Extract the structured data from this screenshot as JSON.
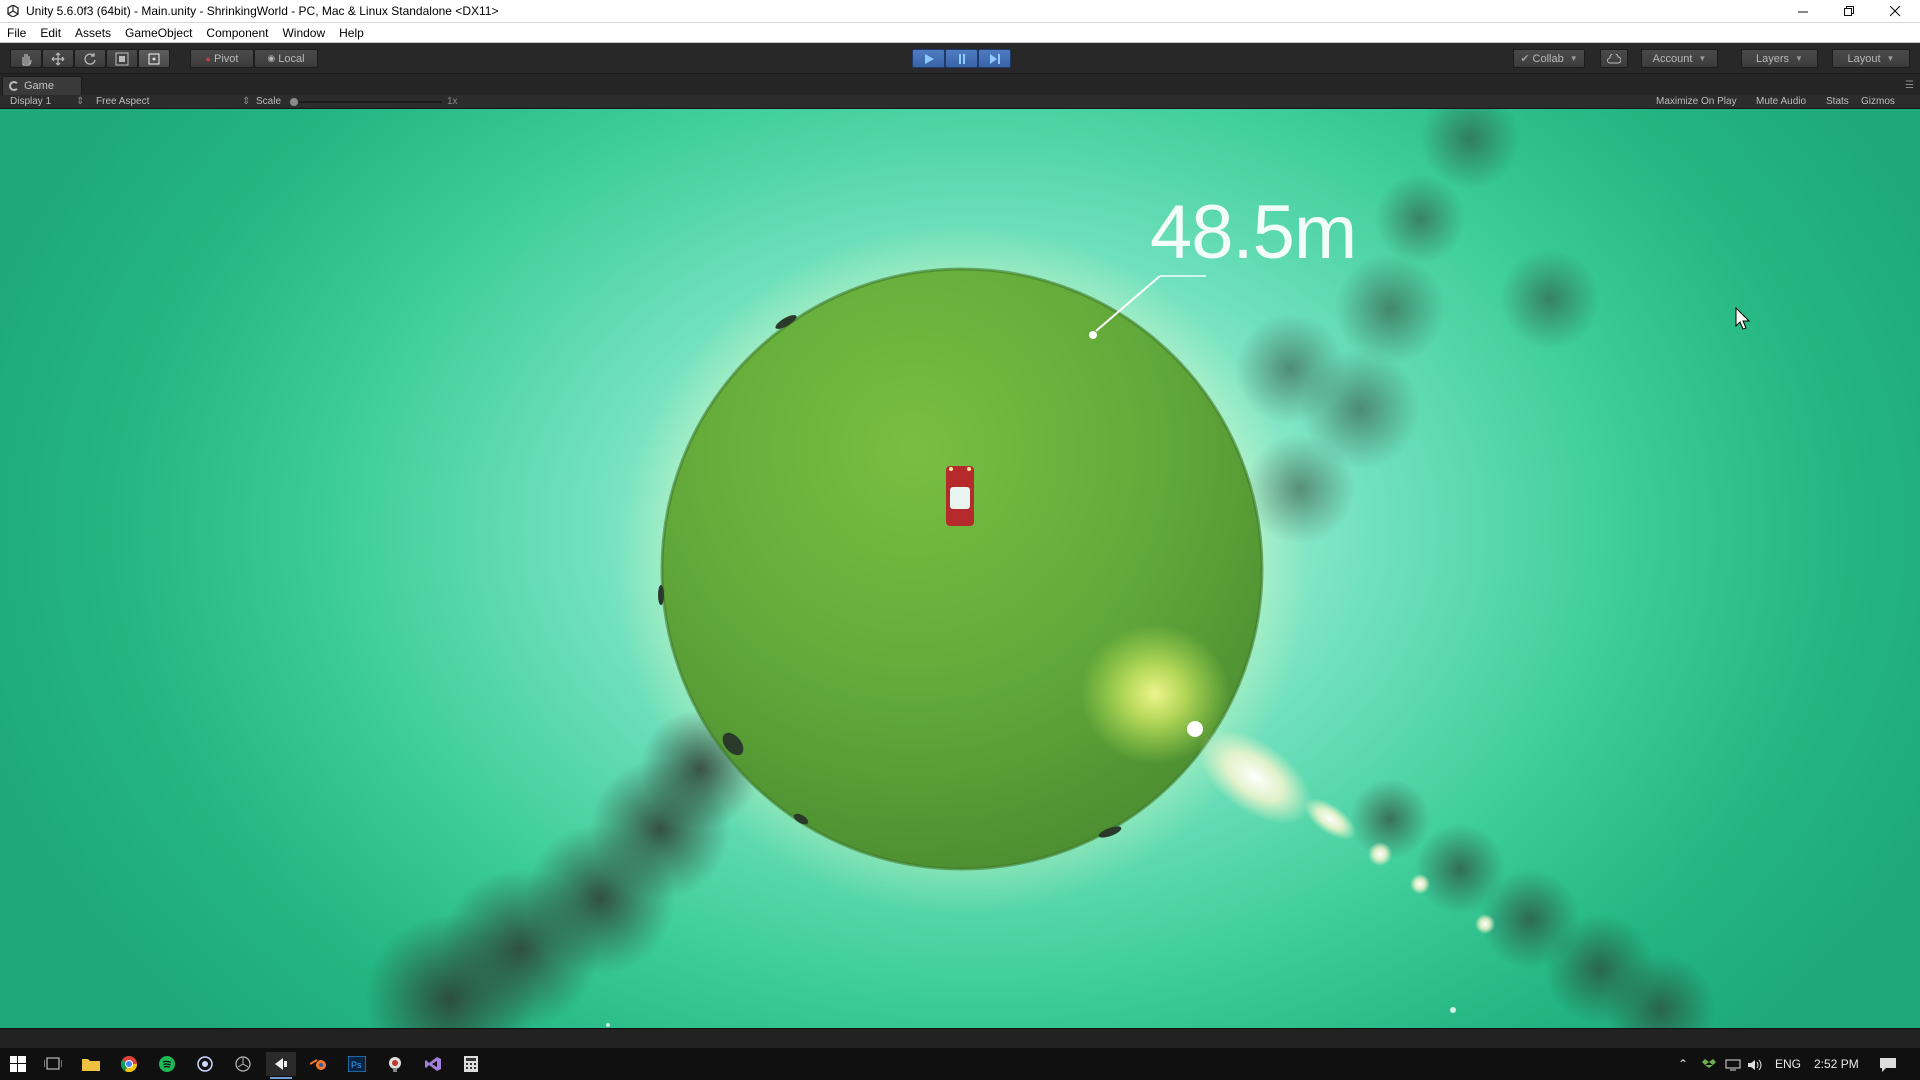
{
  "window": {
    "title": "Unity 5.6.0f3 (64bit) - Main.unity - ShrinkingWorld - PC, Mac & Linux Standalone <DX11>",
    "minimize_icon": "minimize-icon",
    "restore_icon": "restore-icon",
    "close_icon": "close-icon"
  },
  "menu": {
    "items": [
      "File",
      "Edit",
      "Assets",
      "GameObject",
      "Component",
      "Window",
      "Help"
    ]
  },
  "toolbar": {
    "tools": [
      "hand-tool-icon",
      "move-tool-icon",
      "rotate-tool-icon",
      "scale-tool-icon",
      "rect-tool-icon"
    ],
    "pivot_label": "Pivot",
    "local_label": "Local",
    "collab_label": "Collab",
    "account_label": "Account",
    "layers_label": "Layers",
    "layout_label": "Layout",
    "play_active": true
  },
  "game_view": {
    "tab_label": "Game",
    "display_label": "Display 1",
    "aspect_label": "Free Aspect",
    "scale_label": "Scale",
    "scale_value": "1x",
    "maximize_label": "Maximize On Play",
    "mute_label": "Mute Audio",
    "stats_label": "Stats",
    "gizmos_label": "Gizmos",
    "distance_readout": "48.5m"
  },
  "taskbar": {
    "apps": [
      "start-icon",
      "task-view-icon",
      "file-explorer-icon",
      "chrome-icon",
      "spotify-icon",
      "app-icon",
      "unity-icon",
      "unity-editor-icon",
      "blender-icon",
      "photoshop-icon",
      "app-icon-2",
      "visual-studio-icon",
      "calculator-icon"
    ],
    "language": "ENG",
    "time": "2:52 PM"
  },
  "colors": {
    "sky": "#3ccc99",
    "planet": "#6fb43a",
    "car": "#b52a2a",
    "accent": "#3a64a8"
  }
}
